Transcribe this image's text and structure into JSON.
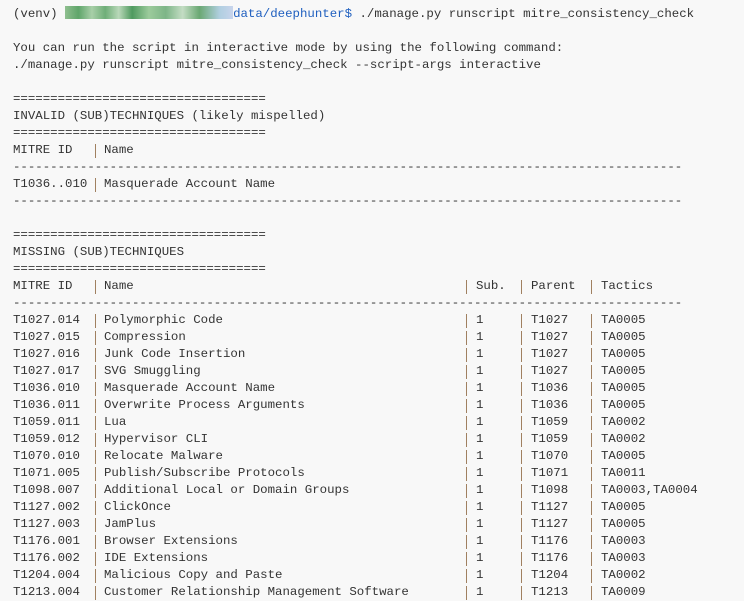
{
  "prompt": {
    "venv": "(venv) ",
    "path": "data/deephunter$",
    "command": " ./manage.py runscript mitre_consistency_check"
  },
  "info": [
    "You can run the script in interactive mode by using the following command:",
    "./manage.py runscript mitre_consistency_check --script-args interactive"
  ],
  "eq_rule": "==================================",
  "dash_rule": "------------------------------------------------------------------------------------------",
  "invalid": {
    "title": "INVALID (SUB)TECHNIQUES (likely mispelled)",
    "headers": [
      "MITRE ID",
      "Name"
    ],
    "rows": [
      [
        "T1036..010",
        "Masquerade Account Name"
      ]
    ]
  },
  "missing": {
    "title": "MISSING (SUB)TECHNIQUES",
    "headers": [
      "MITRE ID",
      "Name",
      "Sub.",
      "Parent",
      "Tactics"
    ],
    "rows": [
      [
        "T1027.014",
        "Polymorphic Code",
        "1",
        "T1027",
        "TA0005"
      ],
      [
        "T1027.015",
        "Compression",
        "1",
        "T1027",
        "TA0005"
      ],
      [
        "T1027.016",
        "Junk Code Insertion",
        "1",
        "T1027",
        "TA0005"
      ],
      [
        "T1027.017",
        "SVG Smuggling",
        "1",
        "T1027",
        "TA0005"
      ],
      [
        "T1036.010",
        "Masquerade Account Name",
        "1",
        "T1036",
        "TA0005"
      ],
      [
        "T1036.011",
        "Overwrite Process Arguments",
        "1",
        "T1036",
        "TA0005"
      ],
      [
        "T1059.011",
        "Lua",
        "1",
        "T1059",
        "TA0002"
      ],
      [
        "T1059.012",
        "Hypervisor CLI",
        "1",
        "T1059",
        "TA0002"
      ],
      [
        "T1070.010",
        "Relocate Malware",
        "1",
        "T1070",
        "TA0005"
      ],
      [
        "T1071.005",
        "Publish/Subscribe Protocols",
        "1",
        "T1071",
        "TA0011"
      ],
      [
        "T1098.007",
        "Additional Local or Domain Groups",
        "1",
        "T1098",
        "TA0003,TA0004"
      ],
      [
        "T1127.002",
        "ClickOnce",
        "1",
        "T1127",
        "TA0005"
      ],
      [
        "T1127.003",
        "JamPlus",
        "1",
        "T1127",
        "TA0005"
      ],
      [
        "T1176.001",
        "Browser Extensions",
        "1",
        "T1176",
        "TA0003"
      ],
      [
        "T1176.002",
        "IDE Extensions",
        "1",
        "T1176",
        "TA0003"
      ],
      [
        "T1204.004",
        "Malicious Copy and Paste",
        "1",
        "T1204",
        "TA0002"
      ],
      [
        "T1213.004",
        "Customer Relationship Management Software",
        "1",
        "T1213",
        "TA0009"
      ]
    ]
  }
}
